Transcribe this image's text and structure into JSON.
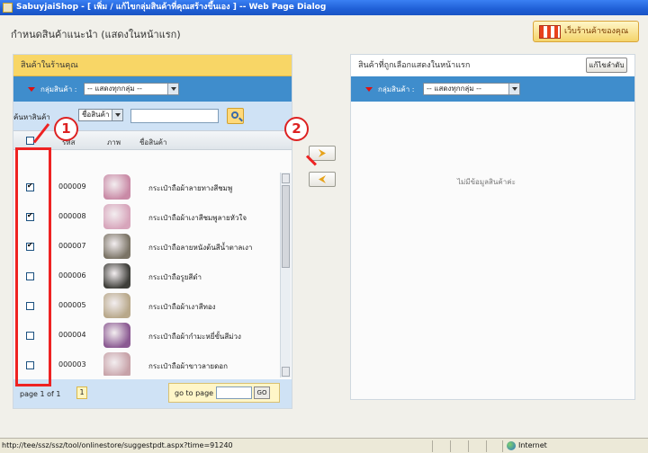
{
  "window": {
    "title": "SabuyjaiShop - [ เพิ่ม / แก้ไขกลุ่มสินค้าที่คุณสร้างขึ้นเอง ] -- Web Page Dialog"
  },
  "page": {
    "title": "กำหนดสินค้าแนะนำ (แสดงในหน้าแรก)",
    "shop_button": "เว็บร้านค้าของคุณ"
  },
  "left_panel": {
    "title": "สินค้าในร้านคุณ",
    "filter_label": "กลุ่มสินค้า :",
    "filter_value": "-- แสดงทุกกลุ่ม --",
    "search_label": "ค้นหาสินค้า",
    "search_field_value": "ชื่อสินค้า",
    "search_value": "",
    "columns": {
      "code": "รหัส",
      "image": "ภาพ",
      "name": "ชื่อสินค้า"
    },
    "rows": [
      {
        "code": "000009",
        "name": "กระเป๋าถือผ้าลายทางสีชมพู",
        "checked": true,
        "image_color": "#c98aa6"
      },
      {
        "code": "000008",
        "name": "กระเป๋าถือผ้าเงาสีชมพูลายหัวใจ",
        "checked": true,
        "image_color": "#d7a5bb"
      },
      {
        "code": "000007",
        "name": "กระเป๋าถือลายหนังต้นสีน้ำตาลเงา",
        "checked": true,
        "image_color": "#7b7466"
      },
      {
        "code": "000006",
        "name": "กระเป๋าถือรูยสีดำ",
        "checked": false,
        "image_color": "#3f3f3a"
      },
      {
        "code": "000005",
        "name": "กระเป๋าถือผ้าเงาสีทอง",
        "checked": false,
        "image_color": "#b8a88a"
      },
      {
        "code": "000004",
        "name": "กระเป๋าถือผ้ากำมะหยี่ขั้นสีม่วง",
        "checked": false,
        "image_color": "#8b5a92"
      },
      {
        "code": "000003",
        "name": "กระเป๋าถือผ้าขาวลายดอก",
        "checked": false,
        "image_color": "#c7a2a8"
      }
    ],
    "pager": {
      "info": "page 1 of 1",
      "current": "1",
      "goto_label": "go to page",
      "goto_value": "",
      "go_button": "GO"
    }
  },
  "right_panel": {
    "title": "สินค้าที่ถูกเลือกแสดงในหน้าแรก",
    "reorder_button": "แก้ไขลำดับ",
    "filter_label": "กลุ่มสินค้า :",
    "filter_value": "-- แสดงทุกกลุ่ม --",
    "empty_text": "ไม่มีข้อมูลสินค้าค่ะ"
  },
  "annotations": {
    "marker1": "1",
    "marker2": "2"
  },
  "statusbar": {
    "url": "http://tee/ssz/ssz/tool/onlinestore/suggestpdt.aspx?time=91240",
    "zone": "Internet"
  },
  "colors": {
    "title_bar": "#1f5fd6",
    "panel_header": "#f8d666",
    "filter_bar": "#3f8dcc",
    "search_bar": "#cfe2f5",
    "annotation": "#dd2222"
  }
}
